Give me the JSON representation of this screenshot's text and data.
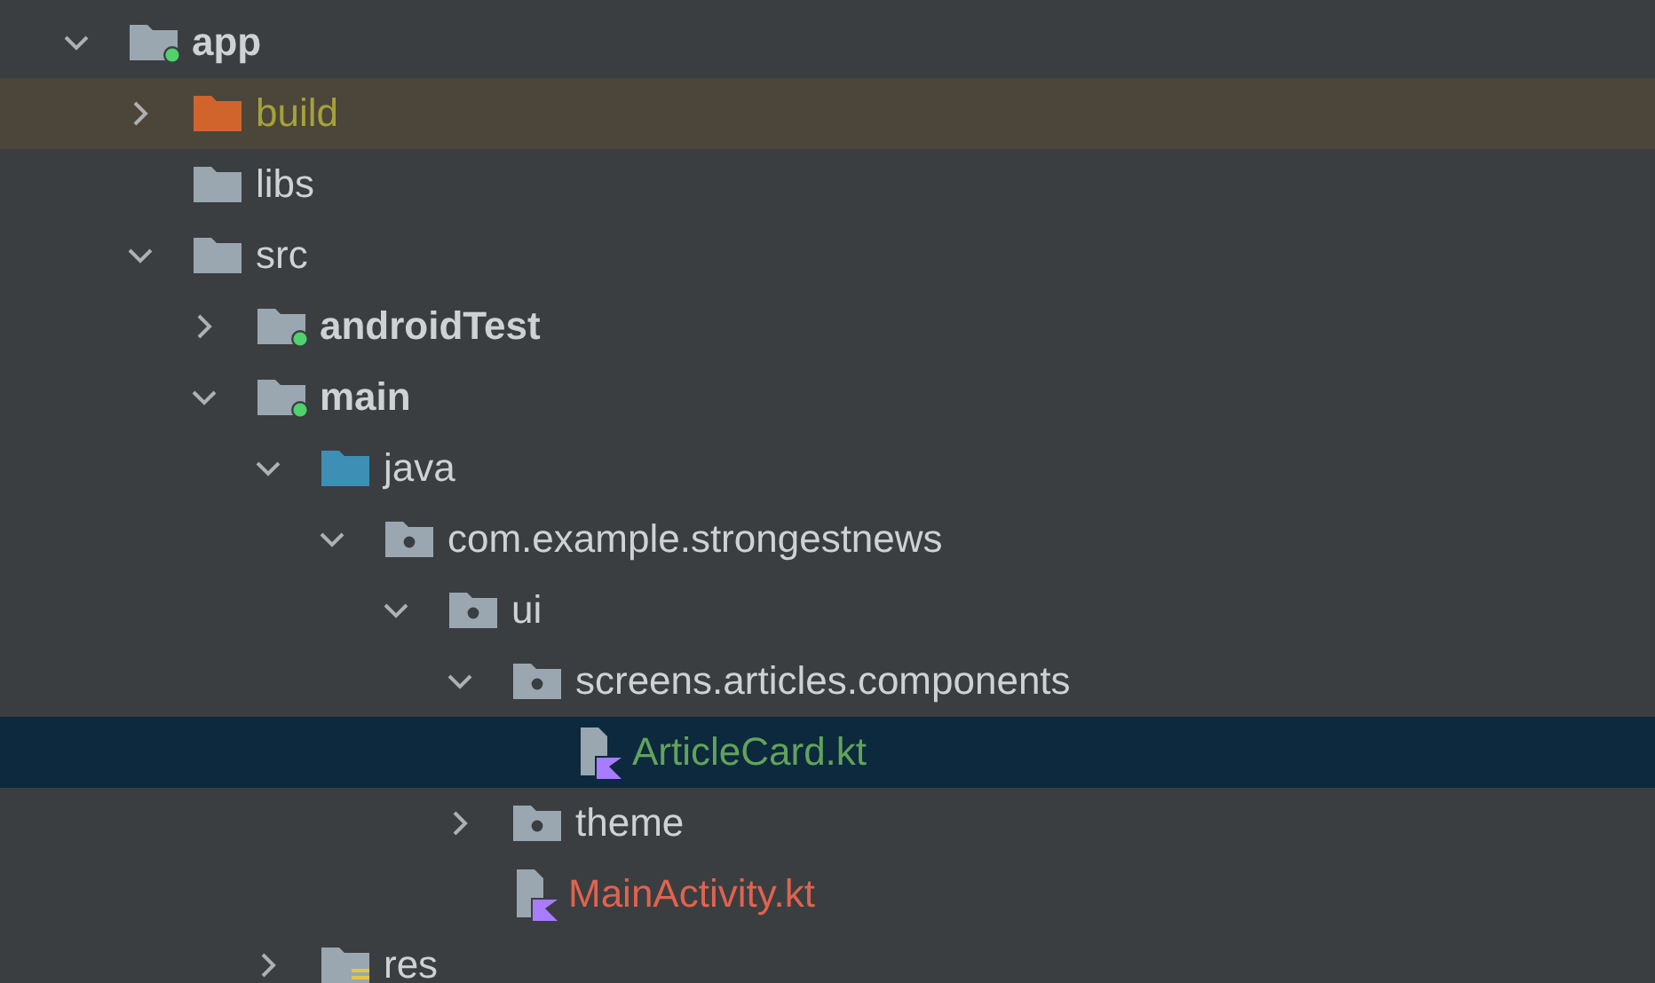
{
  "tree": [
    {
      "label": "app",
      "kind": "module",
      "expanded": true,
      "selected": false,
      "children": [
        {
          "label": "build",
          "kind": "excluded",
          "color": "#a6a13a",
          "expanded": false,
          "selected": false
        },
        {
          "label": "libs",
          "kind": "folder",
          "selected": false
        },
        {
          "label": "src",
          "kind": "folder",
          "expanded": true,
          "selected": false,
          "children": [
            {
              "label": "androidTest",
              "kind": "module",
              "expanded": false,
              "selected": false
            },
            {
              "label": "main",
              "kind": "module",
              "expanded": true,
              "selected": false,
              "children": [
                {
                  "label": "java",
                  "kind": "source",
                  "expanded": true,
                  "selected": false,
                  "children": [
                    {
                      "label": "com.example.strongestnews",
                      "kind": "package",
                      "expanded": true,
                      "selected": false,
                      "children": [
                        {
                          "label": "ui",
                          "kind": "package",
                          "expanded": true,
                          "selected": false,
                          "children": [
                            {
                              "label": "screens.articles.components",
                              "kind": "package",
                              "expanded": true,
                              "selected": false,
                              "children": [
                                {
                                  "label": "ArticleCard.kt",
                                  "kind": "kotlin",
                                  "color": "#62a35a",
                                  "selected": true
                                }
                              ]
                            },
                            {
                              "label": "theme",
                              "kind": "package",
                              "expanded": false,
                              "selected": false
                            },
                            {
                              "label": "MainActivity.kt",
                              "kind": "kotlin",
                              "color": "#e0634f",
                              "selected": false
                            }
                          ]
                        }
                      ]
                    }
                  ]
                },
                {
                  "label": "res",
                  "kind": "resources",
                  "expanded": false,
                  "selected": false
                }
              ]
            }
          ]
        }
      ]
    }
  ]
}
